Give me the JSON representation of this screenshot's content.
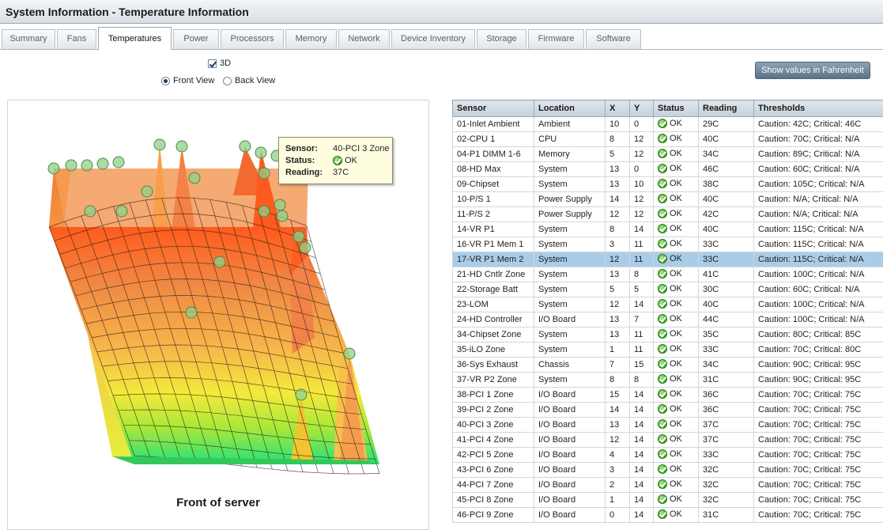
{
  "window": {
    "title": "System Information - Temperature Information"
  },
  "tabs": [
    {
      "label": "Summary"
    },
    {
      "label": "Fans"
    },
    {
      "label": "Temperatures",
      "active": true
    },
    {
      "label": "Power"
    },
    {
      "label": "Processors"
    },
    {
      "label": "Memory"
    },
    {
      "label": "Network"
    },
    {
      "label": "Device Inventory"
    },
    {
      "label": "Storage"
    },
    {
      "label": "Firmware"
    },
    {
      "label": "Software"
    }
  ],
  "view": {
    "three_d_label": "3D",
    "three_d_checked": true,
    "front_label": "Front View",
    "back_label": "Back View",
    "selected": "front"
  },
  "fahrenheit_button": "Show values in Fahrenheit",
  "chart_caption": "Front of server",
  "tooltip": {
    "sensor_label": "Sensor:",
    "sensor": "40-PCI 3 Zone",
    "status_label": "Status:",
    "status": "OK",
    "reading_label": "Reading:",
    "reading": "37C"
  },
  "table": {
    "headers": [
      "Sensor",
      "Location",
      "X",
      "Y",
      "Status",
      "Reading",
      "Thresholds"
    ],
    "rows": [
      [
        "01-Inlet Ambient",
        "Ambient",
        "10",
        "0",
        "OK",
        "29C",
        "Caution: 42C; Critical: 46C"
      ],
      [
        "02-CPU 1",
        "CPU",
        "8",
        "12",
        "OK",
        "40C",
        "Caution: 70C; Critical: N/A"
      ],
      [
        "04-P1 DIMM 1-6",
        "Memory",
        "5",
        "12",
        "OK",
        "34C",
        "Caution: 89C; Critical: N/A"
      ],
      [
        "08-HD Max",
        "System",
        "13",
        "0",
        "OK",
        "46C",
        "Caution: 60C; Critical: N/A"
      ],
      [
        "09-Chipset",
        "System",
        "13",
        "10",
        "OK",
        "38C",
        "Caution: 105C; Critical: N/A"
      ],
      [
        "10-P/S 1",
        "Power Supply",
        "14",
        "12",
        "OK",
        "40C",
        "Caution: N/A; Critical: N/A"
      ],
      [
        "11-P/S 2",
        "Power Supply",
        "12",
        "12",
        "OK",
        "42C",
        "Caution: N/A; Critical: N/A"
      ],
      [
        "14-VR P1",
        "System",
        "8",
        "14",
        "OK",
        "40C",
        "Caution: 115C; Critical: N/A"
      ],
      [
        "16-VR P1 Mem 1",
        "System",
        "3",
        "11",
        "OK",
        "33C",
        "Caution: 115C; Critical: N/A"
      ],
      [
        "17-VR P1 Mem 2",
        "System",
        "12",
        "11",
        "OK",
        "33C",
        "Caution: 115C; Critical: N/A"
      ],
      [
        "21-HD Cntlr Zone",
        "System",
        "13",
        "8",
        "OK",
        "41C",
        "Caution: 100C; Critical: N/A"
      ],
      [
        "22-Storage Batt",
        "System",
        "5",
        "5",
        "OK",
        "30C",
        "Caution: 60C; Critical: N/A"
      ],
      [
        "23-LOM",
        "System",
        "12",
        "14",
        "OK",
        "40C",
        "Caution: 100C; Critical: N/A"
      ],
      [
        "24-HD Controller",
        "I/O Board",
        "13",
        "7",
        "OK",
        "44C",
        "Caution: 100C; Critical: N/A"
      ],
      [
        "34-Chipset Zone",
        "System",
        "13",
        "11",
        "OK",
        "35C",
        "Caution: 80C; Critical: 85C"
      ],
      [
        "35-iLO Zone",
        "System",
        "1",
        "11",
        "OK",
        "33C",
        "Caution: 70C; Critical: 80C"
      ],
      [
        "36-Sys Exhaust",
        "Chassis",
        "7",
        "15",
        "OK",
        "34C",
        "Caution: 90C; Critical: 95C"
      ],
      [
        "37-VR P2 Zone",
        "System",
        "8",
        "8",
        "OK",
        "31C",
        "Caution: 90C; Critical: 95C"
      ],
      [
        "38-PCI 1 Zone",
        "I/O Board",
        "15",
        "14",
        "OK",
        "36C",
        "Caution: 70C; Critical: 75C"
      ],
      [
        "39-PCI 2 Zone",
        "I/O Board",
        "14",
        "14",
        "OK",
        "36C",
        "Caution: 70C; Critical: 75C"
      ],
      [
        "40-PCI 3 Zone",
        "I/O Board",
        "13",
        "14",
        "OK",
        "37C",
        "Caution: 70C; Critical: 75C"
      ],
      [
        "41-PCI 4 Zone",
        "I/O Board",
        "12",
        "14",
        "OK",
        "37C",
        "Caution: 70C; Critical: 75C"
      ],
      [
        "42-PCI 5 Zone",
        "I/O Board",
        "4",
        "14",
        "OK",
        "33C",
        "Caution: 70C; Critical: 75C"
      ],
      [
        "43-PCI 6 Zone",
        "I/O Board",
        "3",
        "14",
        "OK",
        "32C",
        "Caution: 70C; Critical: 75C"
      ],
      [
        "44-PCI 7 Zone",
        "I/O Board",
        "2",
        "14",
        "OK",
        "32C",
        "Caution: 70C; Critical: 75C"
      ],
      [
        "45-PCI 8 Zone",
        "I/O Board",
        "1",
        "14",
        "OK",
        "32C",
        "Caution: 70C; Critical: 75C"
      ],
      [
        "46-PCI 9 Zone",
        "I/O Board",
        "0",
        "14",
        "OK",
        "31C",
        "Caution: 70C; Critical: 75C"
      ]
    ],
    "selected_row": 9
  },
  "colors": {
    "selected_row": "#a9cde9",
    "button": "#6f869c",
    "surface_hot": "#ff5a1e",
    "surface_cool": "#2ee07a"
  }
}
